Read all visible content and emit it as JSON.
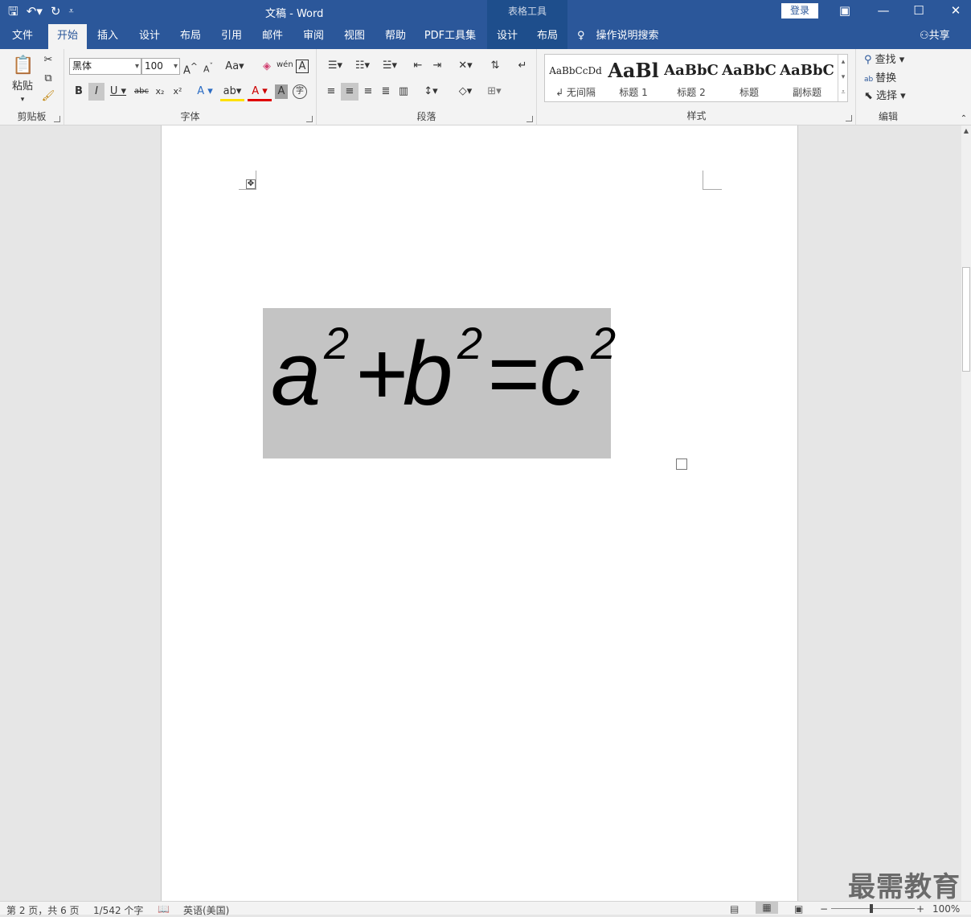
{
  "titlebar": {
    "title": "文稿  -  Word",
    "context_tab": "表格工具",
    "login": "登录"
  },
  "tabs": [
    "文件",
    "开始",
    "插入",
    "设计",
    "布局",
    "引用",
    "邮件",
    "审阅",
    "视图",
    "帮助",
    "PDF工具集",
    "设计",
    "布局"
  ],
  "tell_me": "操作说明搜索",
  "share": "共享",
  "ribbon": {
    "clipboard": {
      "label": "剪贴板",
      "paste": "粘贴"
    },
    "font": {
      "label": "字体",
      "name": "黑体",
      "size": "100"
    },
    "paragraph": {
      "label": "段落"
    },
    "styles": {
      "label": "样式",
      "items": [
        {
          "sample": "AaBbCcDd",
          "name": "↲ 无间隔"
        },
        {
          "sample": "AaBl",
          "name": "标题 1"
        },
        {
          "sample": "AaBbC",
          "name": "标题 2"
        },
        {
          "sample": "AaBbC",
          "name": "标题"
        },
        {
          "sample": "AaBbC",
          "name": "副标题"
        }
      ]
    },
    "editing": {
      "label": "编辑",
      "find": "查找",
      "replace": "替换",
      "select": "选择"
    }
  },
  "document": {
    "formula": {
      "a": "a",
      "plus": "+",
      "b": "b",
      "eq": "=",
      "c": "c",
      "exp": "2"
    }
  },
  "statusbar": {
    "page": "第 2 页，共 6 页",
    "words": "1/542 个字",
    "language": "英语(美国)",
    "zoom": "100%"
  },
  "watermark": "最需教育",
  "colors": {
    "brand": "#2b579a",
    "cell_shading": "#c4c4c4"
  }
}
